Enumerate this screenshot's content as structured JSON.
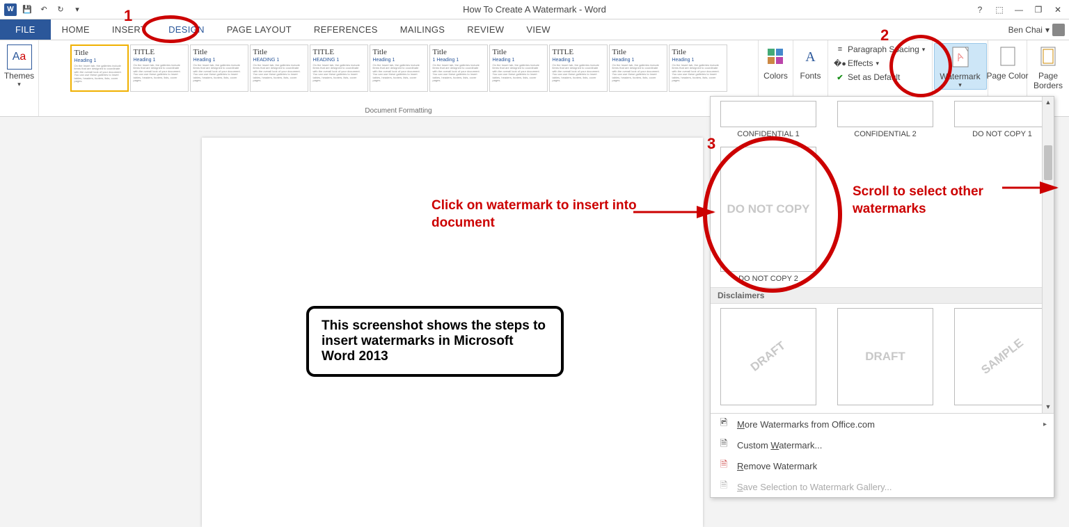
{
  "titlebar": {
    "title": "How To Create A Watermark - Word",
    "user": "Ben Chai"
  },
  "tabs": {
    "file": "FILE",
    "home": "HOME",
    "insert": "INSERT",
    "design": "DESIGN",
    "pagelayout": "PAGE LAYOUT",
    "references": "REFERENCES",
    "mailings": "MAILINGS",
    "review": "REVIEW",
    "view": "VIEW"
  },
  "ribbon": {
    "themes": "Themes",
    "doc_formatting": "Document Formatting",
    "colors": "Colors",
    "fonts": "Fonts",
    "para_spacing": "Paragraph Spacing",
    "effects": "Effects",
    "set_default": "Set as Default",
    "watermark": "Watermark",
    "page_color": "Page Color",
    "page_borders": "Page Borders",
    "style_thumbs": [
      {
        "title": "Title",
        "head": "Heading 1"
      },
      {
        "title": "TITLE",
        "head": "Heading 1"
      },
      {
        "title": "Title",
        "head": "Heading 1"
      },
      {
        "title": "Title",
        "head": "HEADING 1"
      },
      {
        "title": "TITLE",
        "head": "HEADING 1"
      },
      {
        "title": "Title",
        "head": "Heading 1"
      },
      {
        "title": "Title",
        "head": "1  Heading 1"
      },
      {
        "title": "Title",
        "head": "Heading 1"
      },
      {
        "title": "TITLE",
        "head": "Heading 1"
      },
      {
        "title": "Title",
        "head": "Heading 1"
      },
      {
        "title": "Title",
        "head": "Heading 1"
      }
    ]
  },
  "wm_panel": {
    "row1": [
      {
        "text": "",
        "cap": "CONFIDENTIAL 1"
      },
      {
        "text": "",
        "cap": "CONFIDENTIAL 2"
      },
      {
        "text": "",
        "cap": "DO NOT COPY 1"
      }
    ],
    "row2": [
      {
        "text": "DO NOT COPY",
        "cap": "DO NOT COPY 2"
      }
    ],
    "section": "Disclaimers",
    "row3": [
      {
        "text": "DRAFT",
        "diag": true
      },
      {
        "text": "DRAFT",
        "diag": false
      },
      {
        "text": "SAMPLE",
        "diag": true
      }
    ],
    "menu": {
      "more": "More Watermarks from Office.com",
      "custom": "Custom Watermark...",
      "remove": "Remove Watermark",
      "save": "Save Selection to Watermark Gallery..."
    }
  },
  "annotations": {
    "n1": "1",
    "n2": "2",
    "n3": "3",
    "click_text": "Click on watermark to insert into document",
    "scroll_text": "Scroll to select other watermarks",
    "callout": "This screenshot shows the steps to insert watermarks in Microsoft Word 2013"
  }
}
